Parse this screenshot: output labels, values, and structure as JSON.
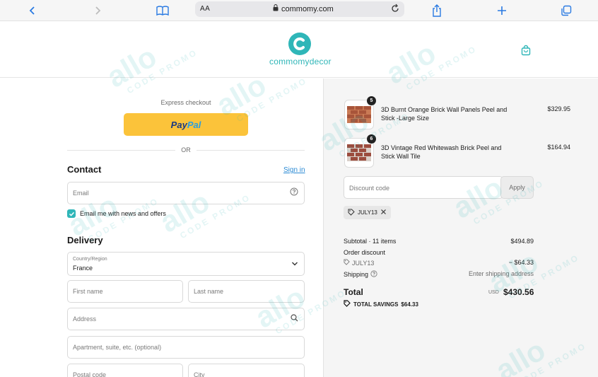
{
  "browser": {
    "text_size": "AA",
    "url": "commomy.com"
  },
  "header": {
    "logo_text": "commomydecor"
  },
  "checkout": {
    "express_label": "Express checkout",
    "paypal_pay": "Pay",
    "paypal_pal": "Pal",
    "or_text": "OR",
    "contact_title": "Contact",
    "sign_in": "Sign in",
    "email_placeholder": "Email",
    "newsletter_label": "Email me with news and offers",
    "delivery_title": "Delivery",
    "country_label": "Country/Region",
    "country_value": "France",
    "first_name_placeholder": "First name",
    "last_name_placeholder": "Last name",
    "address_placeholder": "Address",
    "apartment_placeholder": "Apartment, suite, etc. (optional)",
    "postal_placeholder": "Postal code",
    "city_placeholder": "City"
  },
  "cart": {
    "items": [
      {
        "qty": "5",
        "title": "3D Burnt Orange Brick Wall Panels Peel and Stick -Large Size",
        "price": "$329.95"
      },
      {
        "qty": "6",
        "title": "3D Vintage Red Whitewash Brick Peel and Stick Wall Tile",
        "price": "$164.94"
      }
    ],
    "discount_placeholder": "Discount code",
    "apply_label": "Apply",
    "applied_code": "JULY13",
    "subtotal_label": "Subtotal · 11 items",
    "subtotal_value": "$494.89",
    "order_discount_label": "Order discount",
    "order_discount_code": "JULY13",
    "order_discount_value": "− $64.33",
    "shipping_label": "Shipping",
    "shipping_value": "Enter shipping address",
    "total_label": "Total",
    "total_currency": "USD",
    "total_value": "$430.56",
    "savings_label": "TOTAL SAVINGS",
    "savings_value": "$64.33"
  },
  "watermark": {
    "word": "allo",
    "sub": "CODE PROMO"
  },
  "colors": {
    "brand": "#2fb6b8",
    "paypal_yellow": "#fbc33a",
    "link": "#2a8ad4"
  }
}
